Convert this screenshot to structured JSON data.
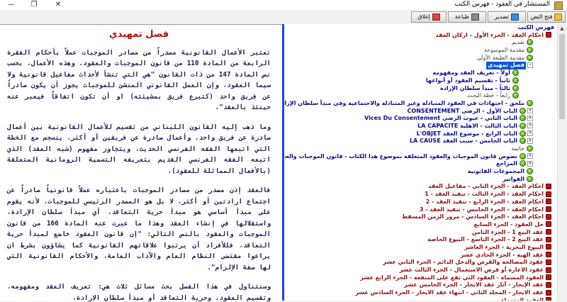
{
  "window": {
    "title": "المستشار في العقود - فهرس الكتب",
    "minimize": "—",
    "maximize": "❐",
    "close": "✕"
  },
  "toolbar": {
    "open": "فتح النص",
    "export": "تصدير",
    "print": "طباعة",
    "close": "إغلاق"
  },
  "tree": [
    {
      "label": "فهرس الكتب",
      "level": 0,
      "color": "blue",
      "icon": "none"
    },
    {
      "label": "احكام العقد - الجزء الأول - اركان العقد",
      "level": 1,
      "color": "red",
      "icon": "red-book"
    },
    {
      "label": "تقديم",
      "level": 2,
      "color": "plain",
      "icon": "green-page"
    },
    {
      "label": "مقدمة الموسوعة",
      "level": 2,
      "color": "plain",
      "icon": "green-page"
    },
    {
      "label": "مقدمة الطبعة الأولى",
      "level": 2,
      "color": "plain",
      "icon": "green-page"
    },
    {
      "label": "فصل تمهيدي",
      "level": 2,
      "color": "blue",
      "icon": "none",
      "selected": true,
      "expander": "-"
    },
    {
      "label": "أولاً - تعريف العقد ومفهومه",
      "level": 3,
      "color": "blue",
      "icon": "green-page"
    },
    {
      "label": "ثانياً - تقسيم العقود أو أنواعها",
      "level": 3,
      "color": "blue",
      "icon": "green-page"
    },
    {
      "label": "ثالثاً - مبدأ سلطان الإرادة",
      "level": 3,
      "color": "blue",
      "icon": "green-page"
    },
    {
      "label": "رابعاً - خطة البحث",
      "level": 3,
      "color": "plain",
      "icon": "green-page"
    },
    {
      "label": "ملحق - اجتهادات في العقود المتبادلة وغير المتبادلة والاجتماعية وفي مبدأ سلطان الإرادة",
      "level": 2,
      "color": "blue",
      "icon": "green-page"
    },
    {
      "label": "الباب الأول - الرضى CONSENTEMENT",
      "level": 2,
      "color": "blue",
      "icon": "green-page",
      "expander": "+"
    },
    {
      "label": "الباب الثاني - عيوب الرضى Vices Du Consentement",
      "level": 2,
      "color": "blue",
      "icon": "green-page",
      "expander": "+"
    },
    {
      "label": "الباب الثالث - الاهلية LA CAPACITE",
      "level": 2,
      "color": "blue",
      "icon": "green-page",
      "expander": "+"
    },
    {
      "label": "الباب الرابع - موضوع العقد L'OBJET",
      "level": 2,
      "color": "blue",
      "icon": "green-page",
      "expander": "+"
    },
    {
      "label": "الباب الخامس - سبب العقد LA CAUSE",
      "level": 2,
      "color": "blue",
      "icon": "green-page",
      "expander": "+"
    },
    {
      "label": "خاتمة",
      "level": 2,
      "color": "plain",
      "icon": "green-page"
    },
    {
      "label": "نصوص قانون الموجبات والعقود المتعلقة بموضوع هذا الكتاب - قانون الموجبات والعقود",
      "level": 2,
      "color": "blue",
      "icon": "green-page",
      "expander": "+"
    },
    {
      "label": "المراجع",
      "level": 2,
      "color": "blue",
      "icon": "green-page",
      "expander": "+"
    },
    {
      "label": "المجموعات القانونية",
      "level": 2,
      "color": "blue",
      "icon": "green-page"
    },
    {
      "label": "الفواتير",
      "level": 2,
      "color": "blue",
      "icon": "green-page"
    },
    {
      "label": "احكام العقد - الجزء الثاني - مفاعيل العقد",
      "level": 1,
      "color": "red",
      "icon": "red-book"
    },
    {
      "label": "احكام العقد - الجزء الثالث - تنفيذ العقد - 1",
      "level": 1,
      "color": "red",
      "icon": "red-book"
    },
    {
      "label": "احكام العقد - الجزء الرابع - تنفيذ العقد - 2",
      "level": 1,
      "color": "red",
      "icon": "red-book"
    },
    {
      "label": "احكام العقد - الجزء الخامس - تنفيذ العقد - 3",
      "level": 1,
      "color": "red",
      "icon": "red-book"
    },
    {
      "label": "احكام العقد - الجزء السادس - مرور الزمن المسقط",
      "level": 1,
      "color": "red",
      "icon": "red-book"
    },
    {
      "label": "حل العقود - الجزء السابع",
      "level": 1,
      "color": "red",
      "icon": "red-book"
    },
    {
      "label": "عقد البيع 1 - الجزء الثامن",
      "level": 1,
      "color": "red",
      "icon": "red-book"
    },
    {
      "label": "عقد البيع 2 - الجزء التاسع - البيوع الخاصة",
      "level": 1,
      "color": "red",
      "icon": "red-book"
    },
    {
      "label": "البيوع البحرية - الجزء العاشر",
      "level": 1,
      "color": "red",
      "icon": "red-book"
    },
    {
      "label": "عقد الهبة - الجزء الحادي عشر",
      "level": 1,
      "color": "red",
      "icon": "red-book"
    },
    {
      "label": "عقود المصالحة والقرض والدخل الدائم - الجزء الثاني عشر",
      "level": 1,
      "color": "red",
      "icon": "red-book"
    },
    {
      "label": "عقود الاعارة أو قرض الاستعمال - الجزء الثالث عشر",
      "level": 1,
      "color": "red",
      "icon": "red-book"
    },
    {
      "label": "العقود المسماة - العقود التي تقع على المنفعة - الجزء الرابع عشر",
      "level": 1,
      "color": "red",
      "icon": "red-book"
    },
    {
      "label": "عقد الإيجار - آثار عقد الايجار - الجزء الخامس عشر",
      "level": 1,
      "color": "red",
      "icon": "red-book"
    },
    {
      "label": "عقد الايجار - المجلد الثاني - انتهاء عقد الايجار - الجزء السادس عشر",
      "level": 1,
      "color": "red",
      "icon": "red-book"
    },
    {
      "label": "العقود المسماة",
      "level": 1,
      "color": "red",
      "icon": "red-book"
    }
  ],
  "document": {
    "heading": "فصل تمهيدي",
    "paragraphs": [
      "تعتبر الأعمال القانونية مصدراً من مصادر الموجبات عملاً بأحكام الفقرة الرابعة من المادة 110 من قانون الموجبات والعقود. وهذه الأعمال، بحسب نص المادة 147 من ذات القانون \"هي التي تنشأ لأحداث مفاعيل قانونية ولا سيما العقود، وإن العمل القانوني المنشئ للموجبات يجوز أن يكون صادراً عن فريق واحد (كتبرع فريق بمشيئته) او أن تكون اتفاقاً فيعبر عنه حينئذ بالعقد\".",
      "وما ذهب إليه القانون اللبناني من تقسيم للأعمال القانونية بين أعمال صادرة عن فريق واحد، وأعمال صادرة عن فريقين أو أكثر، ينسجم مع الخطة التي اتبعها الفقه الفرنسي الحديث، ويتجاوز مفهوم (شبه العقد) الذي اتبعه الفقه الفرنسي القديم بتعريفه التسمية الرومانية المتعلقة (بالأفعال المماثلة للعقود).",
      "فالعقد إذن مصدر من مصادر الموجبات باعتباره عملاً قانونياً صادراً عن اجتماع ارادتين أو أكثر، لا بل هو المصدر الرئيسي للموجبات، لأنه يقوم على مبدأ أساسي هو مبدأ حرية التعاقد، أي مبدأ سلطان الإرادة، واستقلالها في إنشاء العقد وهذا ما عبرت عنه المادة 166 من قانون الموجبات والعقود بالنص التالي: \"إن قانون العقود خاضع لمبدأ حرية التعاقد، فللأفراد أن يرتبوا علاقاتهم القانونية كما يشاؤون بشرط ان يراعوا مقتضى النظام العام والآداب العامة، والأحكام القانونية التي لها صفة الإلزام\".",
      "وسنتناول في هذا الفصل بحث مسائل ثلاث هي: تعريف العقد ومفهومه، وتقسيم العقود، وحرية التعاقد أو مبدأ سلطان الإرادة."
    ]
  }
}
